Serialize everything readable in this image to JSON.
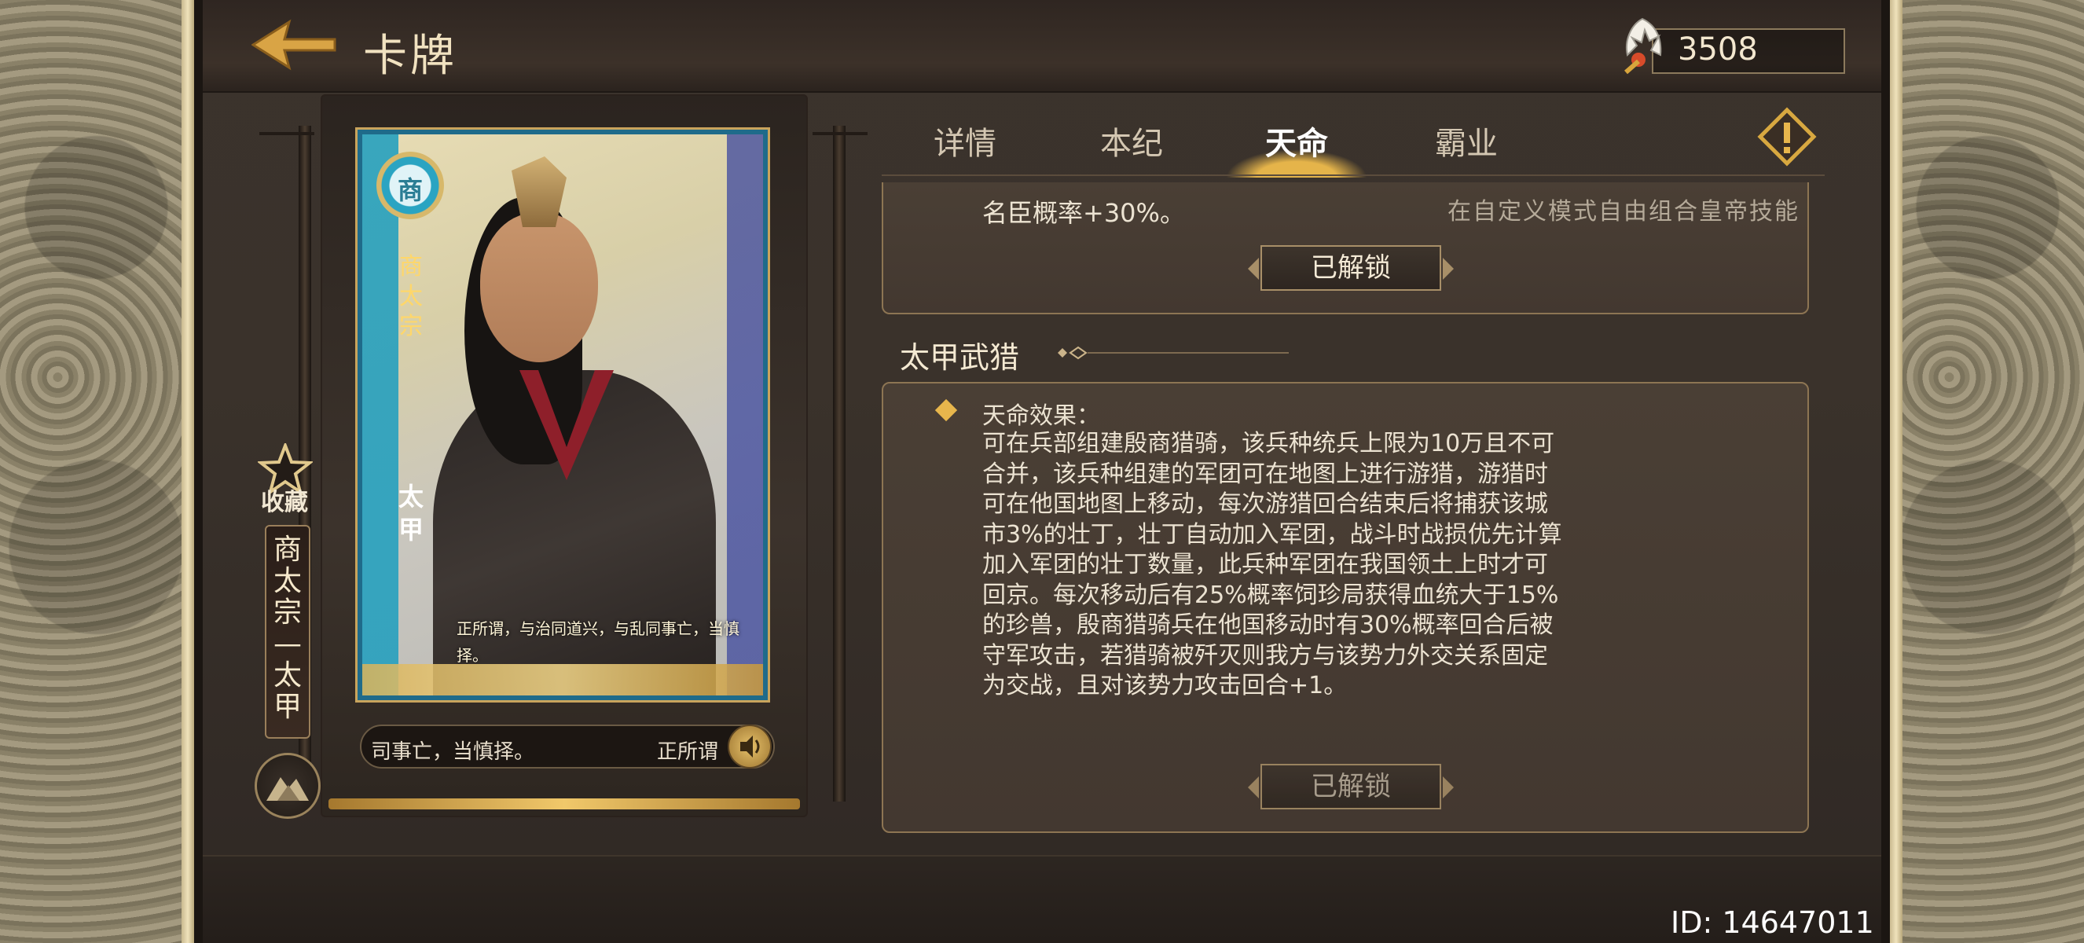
{
  "header": {
    "title": "卡牌",
    "currency_value": "3508"
  },
  "tabs": [
    {
      "label": "详情",
      "active": false
    },
    {
      "label": "本纪",
      "active": false
    },
    {
      "label": "天命",
      "active": true
    },
    {
      "label": "霸业",
      "active": false
    }
  ],
  "card": {
    "seal_char": "商",
    "dynasty_label": "商太宗",
    "name_label": "太甲",
    "quote": "正所谓，与治同道兴，与乱同事亡，当慎择。"
  },
  "sidebar": {
    "favorite_label": "收藏",
    "emperor_plate": "商太宗—太甲"
  },
  "voice": {
    "line_text": "司事亡，当慎择。",
    "line_text_tail": "正所谓"
  },
  "prev_entry": {
    "bonus_text": "名臣概率+30%。",
    "custom_hint": "在自定义模式自由组合皇帝技能",
    "button_label": "已解锁"
  },
  "entry": {
    "title": "太甲武猎",
    "effect_label": "天命效果：",
    "effect_lines": [
      "可在兵部组建殷商猎骑，该兵种统兵上限为10万且不可",
      "合并，该兵种组建的军团可在地图上进行游猎，游猎时",
      "可在他国地图上移动，每次游猎回合结束后将捕获该城",
      "市3%的壮丁，壮丁自动加入军团，战斗时战损优先计算",
      "加入军团的壮丁数量，此兵种军团在我国领土上时才可",
      "回京。每次移动后有25%概率饲珍局获得血统大于15%",
      "的珍兽，殷商猎骑兵在他国移动时有30%概率回合后被",
      "守军攻击，若猎骑被歼灭则我方与该势力外交关系固定",
      "为交战，且对该势力攻击回合+1。"
    ],
    "button_label": "已解锁"
  },
  "footer": {
    "player_id": "ID: 14647011"
  },
  "colors": {
    "accent_gold": "#e8b64c",
    "panel_border": "#8d7553",
    "background": "#3a322b"
  }
}
